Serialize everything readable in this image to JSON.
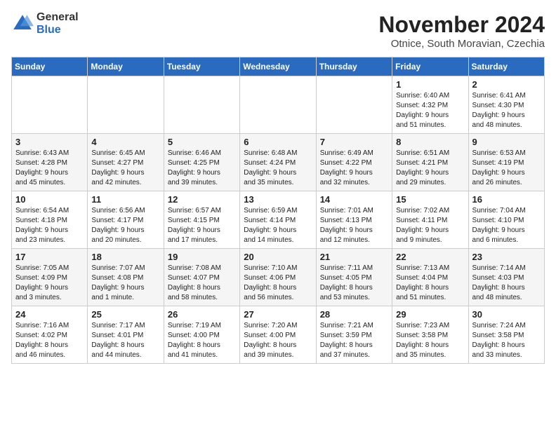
{
  "logo": {
    "general": "General",
    "blue": "Blue"
  },
  "title": "November 2024",
  "location": "Otnice, South Moravian, Czechia",
  "days_of_week": [
    "Sunday",
    "Monday",
    "Tuesday",
    "Wednesday",
    "Thursday",
    "Friday",
    "Saturday"
  ],
  "weeks": [
    [
      {
        "day": "",
        "info": ""
      },
      {
        "day": "",
        "info": ""
      },
      {
        "day": "",
        "info": ""
      },
      {
        "day": "",
        "info": ""
      },
      {
        "day": "",
        "info": ""
      },
      {
        "day": "1",
        "info": "Sunrise: 6:40 AM\nSunset: 4:32 PM\nDaylight: 9 hours\nand 51 minutes."
      },
      {
        "day": "2",
        "info": "Sunrise: 6:41 AM\nSunset: 4:30 PM\nDaylight: 9 hours\nand 48 minutes."
      }
    ],
    [
      {
        "day": "3",
        "info": "Sunrise: 6:43 AM\nSunset: 4:28 PM\nDaylight: 9 hours\nand 45 minutes."
      },
      {
        "day": "4",
        "info": "Sunrise: 6:45 AM\nSunset: 4:27 PM\nDaylight: 9 hours\nand 42 minutes."
      },
      {
        "day": "5",
        "info": "Sunrise: 6:46 AM\nSunset: 4:25 PM\nDaylight: 9 hours\nand 39 minutes."
      },
      {
        "day": "6",
        "info": "Sunrise: 6:48 AM\nSunset: 4:24 PM\nDaylight: 9 hours\nand 35 minutes."
      },
      {
        "day": "7",
        "info": "Sunrise: 6:49 AM\nSunset: 4:22 PM\nDaylight: 9 hours\nand 32 minutes."
      },
      {
        "day": "8",
        "info": "Sunrise: 6:51 AM\nSunset: 4:21 PM\nDaylight: 9 hours\nand 29 minutes."
      },
      {
        "day": "9",
        "info": "Sunrise: 6:53 AM\nSunset: 4:19 PM\nDaylight: 9 hours\nand 26 minutes."
      }
    ],
    [
      {
        "day": "10",
        "info": "Sunrise: 6:54 AM\nSunset: 4:18 PM\nDaylight: 9 hours\nand 23 minutes."
      },
      {
        "day": "11",
        "info": "Sunrise: 6:56 AM\nSunset: 4:17 PM\nDaylight: 9 hours\nand 20 minutes."
      },
      {
        "day": "12",
        "info": "Sunrise: 6:57 AM\nSunset: 4:15 PM\nDaylight: 9 hours\nand 17 minutes."
      },
      {
        "day": "13",
        "info": "Sunrise: 6:59 AM\nSunset: 4:14 PM\nDaylight: 9 hours\nand 14 minutes."
      },
      {
        "day": "14",
        "info": "Sunrise: 7:01 AM\nSunset: 4:13 PM\nDaylight: 9 hours\nand 12 minutes."
      },
      {
        "day": "15",
        "info": "Sunrise: 7:02 AM\nSunset: 4:11 PM\nDaylight: 9 hours\nand 9 minutes."
      },
      {
        "day": "16",
        "info": "Sunrise: 7:04 AM\nSunset: 4:10 PM\nDaylight: 9 hours\nand 6 minutes."
      }
    ],
    [
      {
        "day": "17",
        "info": "Sunrise: 7:05 AM\nSunset: 4:09 PM\nDaylight: 9 hours\nand 3 minutes."
      },
      {
        "day": "18",
        "info": "Sunrise: 7:07 AM\nSunset: 4:08 PM\nDaylight: 9 hours\nand 1 minute."
      },
      {
        "day": "19",
        "info": "Sunrise: 7:08 AM\nSunset: 4:07 PM\nDaylight: 8 hours\nand 58 minutes."
      },
      {
        "day": "20",
        "info": "Sunrise: 7:10 AM\nSunset: 4:06 PM\nDaylight: 8 hours\nand 56 minutes."
      },
      {
        "day": "21",
        "info": "Sunrise: 7:11 AM\nSunset: 4:05 PM\nDaylight: 8 hours\nand 53 minutes."
      },
      {
        "day": "22",
        "info": "Sunrise: 7:13 AM\nSunset: 4:04 PM\nDaylight: 8 hours\nand 51 minutes."
      },
      {
        "day": "23",
        "info": "Sunrise: 7:14 AM\nSunset: 4:03 PM\nDaylight: 8 hours\nand 48 minutes."
      }
    ],
    [
      {
        "day": "24",
        "info": "Sunrise: 7:16 AM\nSunset: 4:02 PM\nDaylight: 8 hours\nand 46 minutes."
      },
      {
        "day": "25",
        "info": "Sunrise: 7:17 AM\nSunset: 4:01 PM\nDaylight: 8 hours\nand 44 minutes."
      },
      {
        "day": "26",
        "info": "Sunrise: 7:19 AM\nSunset: 4:00 PM\nDaylight: 8 hours\nand 41 minutes."
      },
      {
        "day": "27",
        "info": "Sunrise: 7:20 AM\nSunset: 4:00 PM\nDaylight: 8 hours\nand 39 minutes."
      },
      {
        "day": "28",
        "info": "Sunrise: 7:21 AM\nSunset: 3:59 PM\nDaylight: 8 hours\nand 37 minutes."
      },
      {
        "day": "29",
        "info": "Sunrise: 7:23 AM\nSunset: 3:58 PM\nDaylight: 8 hours\nand 35 minutes."
      },
      {
        "day": "30",
        "info": "Sunrise: 7:24 AM\nSunset: 3:58 PM\nDaylight: 8 hours\nand 33 minutes."
      }
    ]
  ]
}
